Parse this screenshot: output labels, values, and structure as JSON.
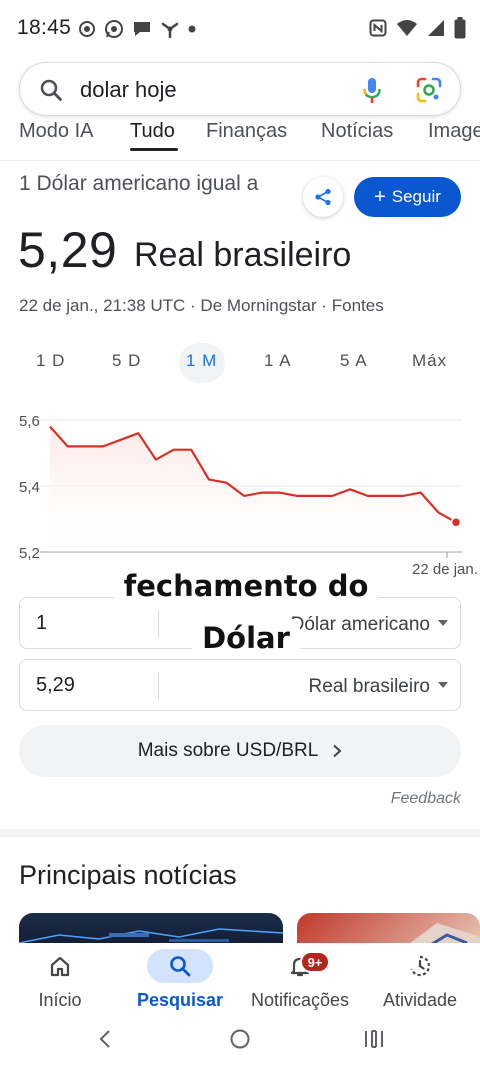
{
  "status_bar": {
    "time": "18:45"
  },
  "search": {
    "query": "dolar hoje"
  },
  "tabs": [
    {
      "label": "Modo IA"
    },
    {
      "label": "Tudo"
    },
    {
      "label": "Finanças"
    },
    {
      "label": "Notícias"
    },
    {
      "label": "Imagens"
    }
  ],
  "converter_card": {
    "title": "1 Dólar americano igual a",
    "value": "5,29",
    "currency": "Real brasileiro",
    "meta": "22 de jan., 21:38 UTC · De Morningstar · Fontes",
    "follow_label": "Seguir",
    "periods": [
      {
        "label": "1 D"
      },
      {
        "label": "5 D"
      },
      {
        "label": "1 M"
      },
      {
        "label": "1 A"
      },
      {
        "label": "5 A"
      },
      {
        "label": "Máx"
      }
    ],
    "active_period": "1 M"
  },
  "chart_data": {
    "type": "area",
    "y_ticks": [
      "5,6",
      "5,4",
      "5,2"
    ],
    "ylim": [
      5.2,
      5.6
    ],
    "x_end_label": "22 de jan.",
    "accent_color": "#d93025",
    "fill_color": "#fce8e6",
    "values": [
      5.58,
      5.52,
      5.52,
      5.52,
      5.54,
      5.56,
      5.48,
      5.51,
      5.51,
      5.42,
      5.41,
      5.37,
      5.38,
      5.38,
      5.37,
      5.37,
      5.37,
      5.39,
      5.37,
      5.37,
      5.37,
      5.38,
      5.32,
      5.29
    ]
  },
  "overlay": {
    "line1": "fechamento do",
    "line2": "Dólar"
  },
  "converter": {
    "from_amount": "1",
    "from_currency": "Dólar americano",
    "to_amount": "5,29",
    "to_currency": "Real brasileiro"
  },
  "more_button": "Mais sobre USD/BRL",
  "feedback": "Feedback",
  "news": {
    "title": "Principais notícias"
  },
  "bottom_nav": [
    {
      "label": "Início",
      "icon": "home-icon"
    },
    {
      "label": "Pesquisar",
      "icon": "search-icon"
    },
    {
      "label": "Notificações",
      "icon": "bell-icon",
      "badge": "9+"
    },
    {
      "label": "Atividade",
      "icon": "activity-icon"
    }
  ]
}
